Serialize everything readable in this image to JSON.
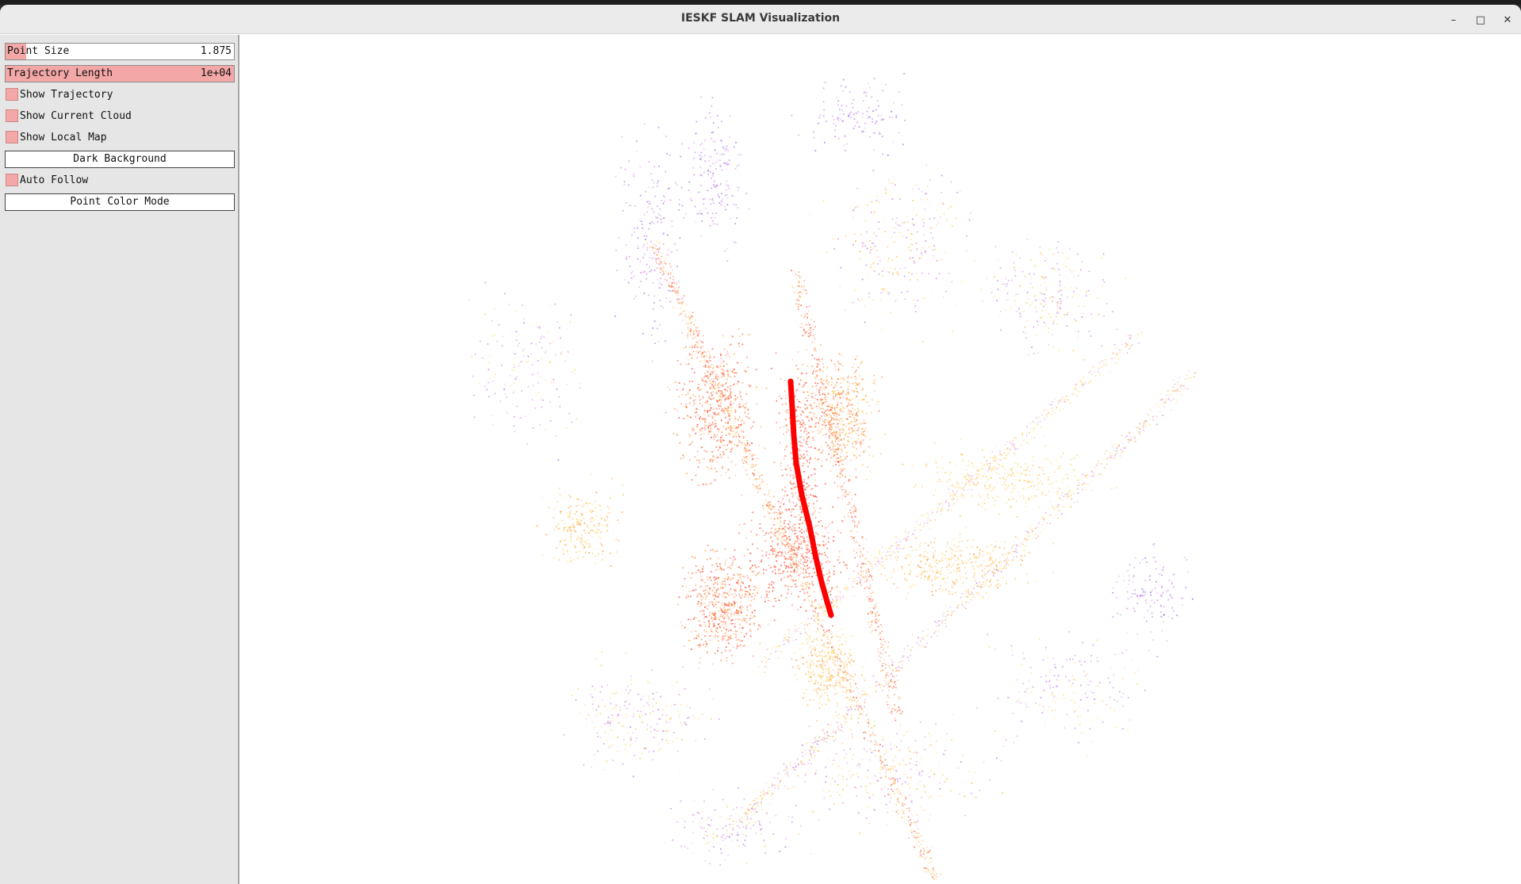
{
  "window": {
    "title": "IESKF SLAM Visualization",
    "controls": {
      "minimize": "–",
      "maximize": "□",
      "close": "✕"
    }
  },
  "panel": {
    "point_size": {
      "label": "Point Size",
      "value": "1.875",
      "fill_fraction": 0.09
    },
    "trajectory_length": {
      "label": "Trajectory Length",
      "value": "1e+04",
      "fill_fraction": 1.0
    },
    "show_trajectory": {
      "label": "Show Trajectory",
      "checked": true
    },
    "show_current_cloud": {
      "label": "Show Current Cloud",
      "checked": true
    },
    "show_local_map": {
      "label": "Show Local Map",
      "checked": true
    },
    "dark_background_button": "Dark Background",
    "auto_follow": {
      "label": "Auto Follow",
      "checked": true
    },
    "point_color_mode_button": "Point Color Mode"
  },
  "colors": {
    "accent": "#f4a7a7",
    "trajectory": "#ff0000",
    "background": "#ffffff",
    "point_palette": [
      "#ff4d3a",
      "#ff7a4a",
      "#ffa64d",
      "#ffc85a",
      "#ffe08a",
      "#e39af0",
      "#c48ae8",
      "#a080e0"
    ]
  }
}
